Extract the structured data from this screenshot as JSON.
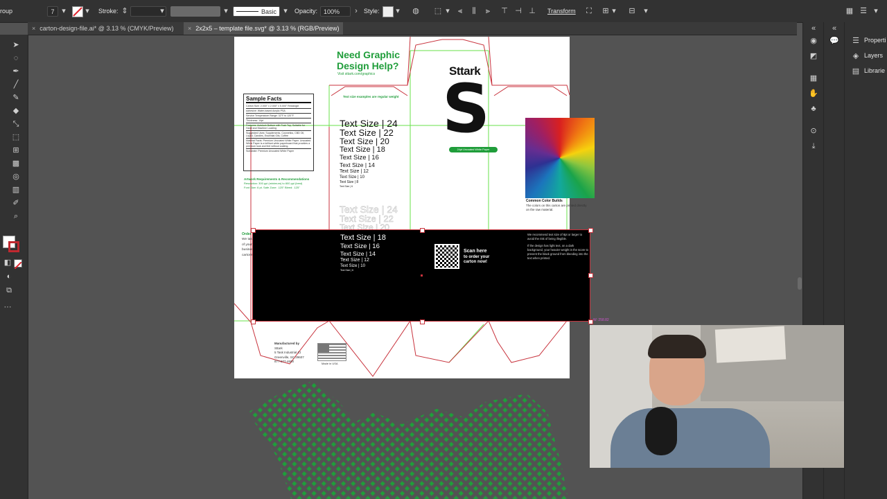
{
  "toolbar_top": {
    "mode_label": "roup",
    "fill_value": "7",
    "stroke_label": "Stroke:",
    "brush_label": "Basic",
    "opacity_label": "Opacity:",
    "opacity_value": "100%",
    "style_label": "Style:",
    "transform_label": "Transform"
  },
  "tabs": [
    {
      "label": "carton-design-file.ai* @ 3.13 % (CMYK/Preview)",
      "close": "×"
    },
    {
      "label": "2x2x5 – template file.svg* @ 3.13 % (RGB/Preview)",
      "close": "×"
    }
  ],
  "panels": {
    "properties": "Properti",
    "layers": "Layers",
    "libraries": "Librarie"
  },
  "artboard": {
    "headline1": "Need Graphic",
    "headline2": "Design Help?",
    "visit": "Visit sttark.com/graphics",
    "text_examples_note": "Text size examples are regular weight",
    "brand": "Sttark",
    "brand_big": "S",
    "substrate_badge": "24pt Uncoated White Paper",
    "facts_title": "Sample Facts",
    "facts": [
      "Carton Size: 2.000\" x 2.000\" x 5.000\" Rectangle",
      "Adhesive: Water-based Acrylic PSA",
      "Service Temperature Range: 32°F to 120°F",
      "Thickness: 14pt",
      "Features: Autolock Bottom with Tuck Top, Suitable for Hand and Machine Loading",
      "Suggested Uses: Supplements, Cosmetics, CBD Oil, Liquid, Candles, Essential Oils, Coffee",
      "Material Facts: Premium Uncoated White Paper. Uncoated White Paper is a brilliant white paperboard that provides a premium look and feel without coating.",
      "Substrate: Premium Uncoated White Paper"
    ],
    "artwork_title": "Artwork Requirements & Recommendations",
    "artwork_line1": "Resolution: 300 ppi (minimum) to 800 ppi (best)",
    "artwork_line2": "Font Size: 6 pt.  Safe Zone: .125\"  Bleed: .125\"",
    "text_sizes": [
      "Text Size | 24",
      "Text Size | 22",
      "Text Size | 20",
      "Text Size | 18",
      "Text Size | 16",
      "Text Size | 14",
      "Text Size | 12",
      "Text Size | 10",
      "Text Size | 8",
      "Text Size | 6"
    ],
    "color_builds_title": "Common Color Builds",
    "color_builds_text": "The colors on this carton are printed directly on the raw material.",
    "order_title": "Order at sttark.com",
    "order_text": "We take pride in our product, so you'll be proud of yours! Our team is dedicated to see your business succeed, whether you need a hundred cartons or hundreds of thousands every week.",
    "scan_here": "Scan here",
    "scan_text": "to order your carton now!",
    "tips1": "We recommend text size of 8pt or larger to avoid the risk of being illegible.",
    "tips2": "If the design has light text, on a dark background, your heavier weight in the score to prevent the black ground from bleeding into the text when printed.",
    "address_title": "Manufactured by",
    "address": [
      "Sttark",
      "5 Task Industrial Ct",
      "Greenville, SC 29607",
      "877-277-4600"
    ],
    "made_in": "Made in USA",
    "dim_label": "W: 258.82"
  },
  "colors": {
    "accent_green": "#1f9d3a",
    "dieline_red": "#c8323c",
    "guide_green": "#67e04a",
    "ui_dark": "#323232",
    "canvas": "#535353"
  }
}
